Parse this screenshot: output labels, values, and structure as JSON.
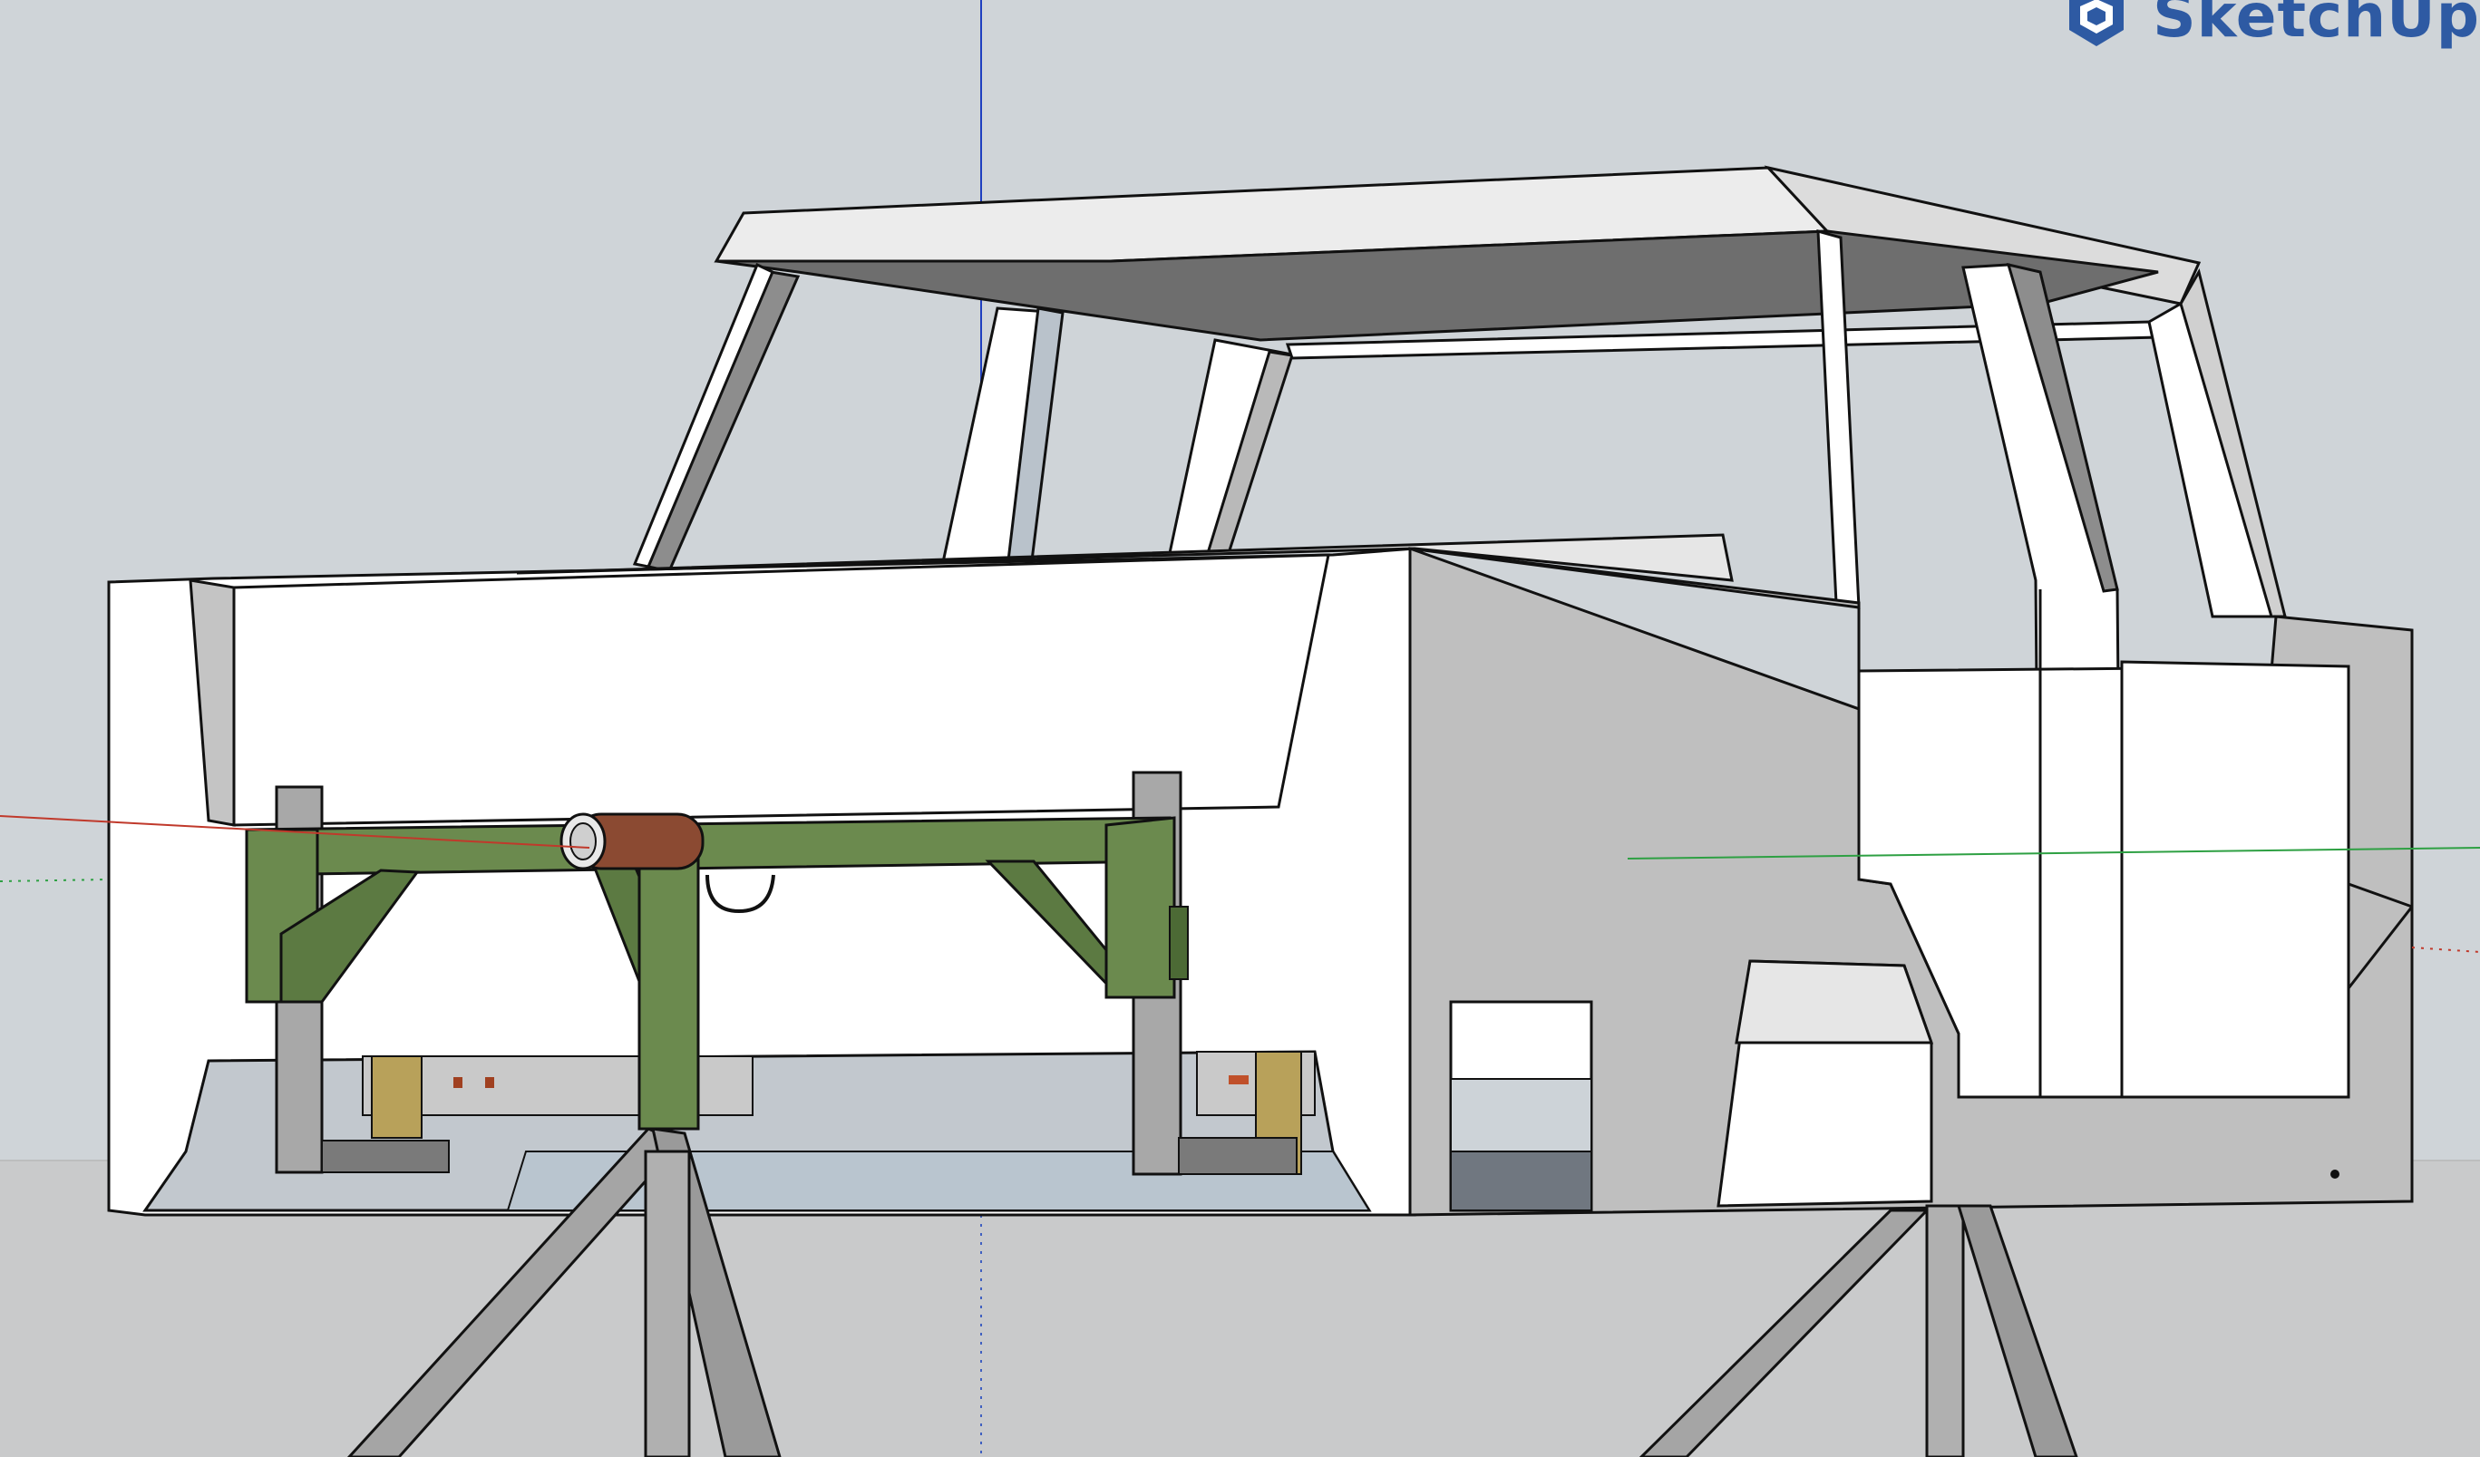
{
  "app": {
    "name": "SketchUp",
    "logo_icon": "sketchup-logo-icon"
  },
  "colors": {
    "sky": "#cfd4d8",
    "ground": "#c9cacb",
    "body_face": "#ffffff",
    "body_side_shadow": "#bfbfbf",
    "roof_underside": "#6e6e6e",
    "frame_green": "#6b8a4e",
    "tube_brown": "#8b4a32",
    "stand_gray": "#9c9c9c",
    "axis_red": "#c0392b",
    "axis_green": "#2ea043",
    "axis_blue": "#1f3fbf",
    "brand_blue": "#2e5aa3"
  },
  "scene": {
    "model": "vehicle-body-on-rotisserie",
    "axes": [
      "red-axis",
      "green-axis",
      "blue-axis"
    ]
  }
}
